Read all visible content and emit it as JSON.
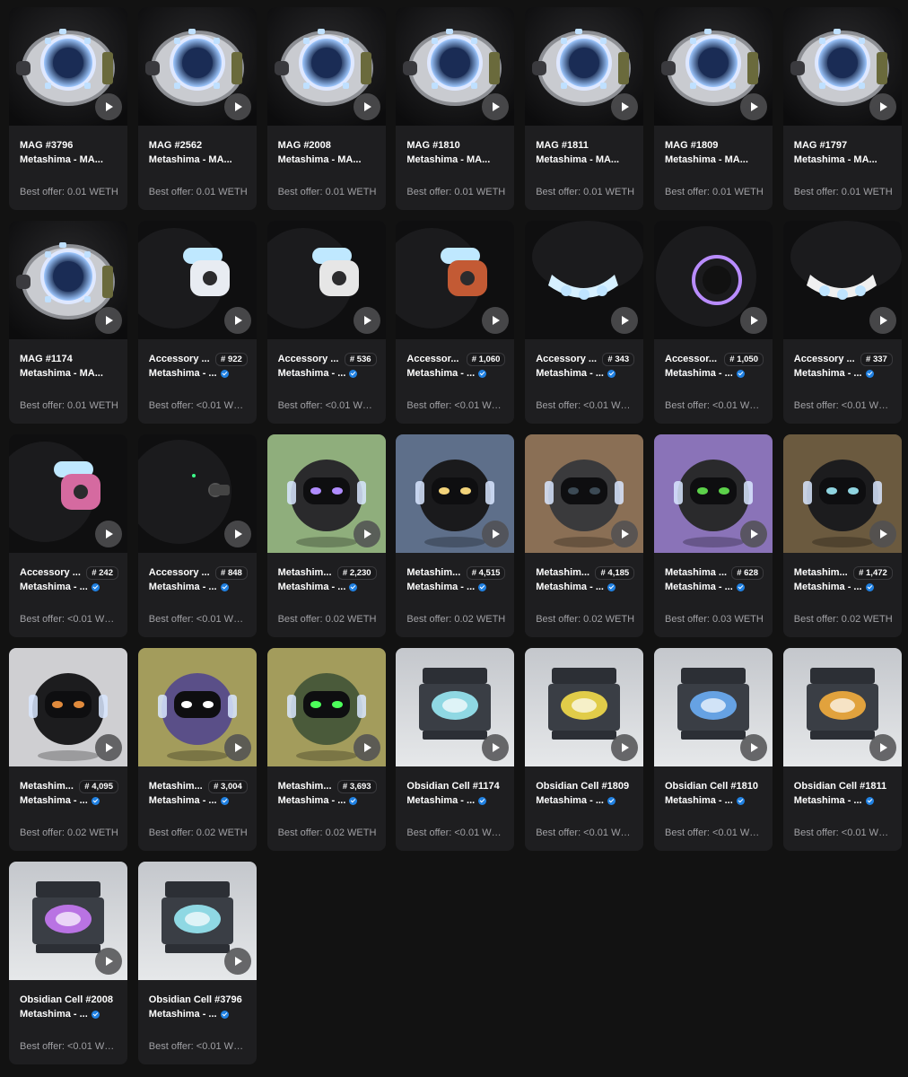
{
  "colors": {
    "background": "#121212",
    "card": "#1e1e20",
    "verified": "#2081e2",
    "muted_text": "#a0a0a4"
  },
  "offer_prefix": "Best offer: ",
  "cards": [
    {
      "title": "MAG #3796",
      "collection": "Metashima - MA...",
      "rank": "",
      "verified": false,
      "offer": "0.01 WETH",
      "image": "mag"
    },
    {
      "title": "MAG #2562",
      "collection": "Metashima - MA...",
      "rank": "",
      "verified": false,
      "offer": "0.01 WETH",
      "image": "mag"
    },
    {
      "title": "MAG #2008",
      "collection": "Metashima - MA...",
      "rank": "",
      "verified": false,
      "offer": "0.01 WETH",
      "image": "mag"
    },
    {
      "title": "MAG #1810",
      "collection": "Metashima - MA...",
      "rank": "",
      "verified": false,
      "offer": "0.01 WETH",
      "image": "mag"
    },
    {
      "title": "MAG #1811",
      "collection": "Metashima - MA...",
      "rank": "",
      "verified": false,
      "offer": "0.01 WETH",
      "image": "mag"
    },
    {
      "title": "MAG #1809",
      "collection": "Metashima - MA...",
      "rank": "",
      "verified": false,
      "offer": "0.01 WETH",
      "image": "mag"
    },
    {
      "title": "MAG #1797",
      "collection": "Metashima - MA...",
      "rank": "",
      "verified": false,
      "offer": "0.01 WETH",
      "image": "mag"
    },
    {
      "title": "MAG #1174",
      "collection": "Metashima - MA...",
      "rank": "",
      "verified": false,
      "offer": "0.01 WETH",
      "image": "mag"
    },
    {
      "title": "Accessory ...",
      "collection": "Metashima - ...",
      "rank": "# 922",
      "verified": true,
      "offer": "<0.01 WE...",
      "image": "acc-white"
    },
    {
      "title": "Accessory ...",
      "collection": "Metashima - ...",
      "rank": "# 536",
      "verified": true,
      "offer": "<0.01 WE...",
      "image": "acc-white2"
    },
    {
      "title": "Accessor...",
      "collection": "Metashima - ...",
      "rank": "# 1,060",
      "verified": true,
      "offer": "<0.01 WE...",
      "image": "acc-orange"
    },
    {
      "title": "Accessory ...",
      "collection": "Metashima - ...",
      "rank": "# 343",
      "verified": true,
      "offer": "<0.01 WE...",
      "image": "acc-legs"
    },
    {
      "title": "Accessor...",
      "collection": "Metashima - ...",
      "rank": "# 1,050",
      "verified": true,
      "offer": "<0.01 WE...",
      "image": "acc-purple"
    },
    {
      "title": "Accessory ...",
      "collection": "Metashima - ...",
      "rank": "# 337",
      "verified": true,
      "offer": "<0.01 WE...",
      "image": "acc-legs2"
    },
    {
      "title": "Accessory ...",
      "collection": "Metashima - ...",
      "rank": "# 242",
      "verified": true,
      "offer": "<0.01 WE...",
      "image": "acc-graffiti"
    },
    {
      "title": "Accessory ...",
      "collection": "Metashima - ...",
      "rank": "# 848",
      "verified": true,
      "offer": "<0.01 WE...",
      "image": "acc-dark"
    },
    {
      "title": "Metashim...",
      "collection": "Metashima - ...",
      "rank": "# 2,230",
      "verified": true,
      "offer": "0.02 WETH",
      "image": "bot-green"
    },
    {
      "title": "Metashim...",
      "collection": "Metashima - ...",
      "rank": "# 4,515",
      "verified": true,
      "offer": "0.02 WETH",
      "image": "bot-blue"
    },
    {
      "title": "Metashim...",
      "collection": "Metashima - ...",
      "rank": "# 4,185",
      "verified": true,
      "offer": "0.02 WETH",
      "image": "bot-brown"
    },
    {
      "title": "Metashima ...",
      "collection": "Metashima - ...",
      "rank": "# 628",
      "verified": true,
      "offer": "0.03 WETH",
      "image": "bot-purple"
    },
    {
      "title": "Metashim...",
      "collection": "Metashima - ...",
      "rank": "# 1,472",
      "verified": true,
      "offer": "0.02 WETH",
      "image": "bot-gold"
    },
    {
      "title": "Metashim...",
      "collection": "Metashima - ...",
      "rank": "# 4,095",
      "verified": true,
      "offer": "0.02 WETH",
      "image": "bot-grey"
    },
    {
      "title": "Metashim...",
      "collection": "Metashima - ...",
      "rank": "# 3,004",
      "verified": true,
      "offer": "0.02 WETH",
      "image": "bot-olive"
    },
    {
      "title": "Metashim...",
      "collection": "Metashima - ...",
      "rank": "# 3,693",
      "verified": true,
      "offer": "0.02 WETH",
      "image": "bot-camo"
    },
    {
      "title": "Obsidian Cell #1174",
      "collection": "Metashima - ...",
      "rank": "",
      "verified": true,
      "offer": "<0.01 WE...",
      "image": "cell-cyan"
    },
    {
      "title": "Obsidian Cell #1809",
      "collection": "Metashima - ...",
      "rank": "",
      "verified": true,
      "offer": "<0.01 WE...",
      "image": "cell-yellow"
    },
    {
      "title": "Obsidian Cell #1810",
      "collection": "Metashima - ...",
      "rank": "",
      "verified": true,
      "offer": "<0.01 WE...",
      "image": "cell-blue"
    },
    {
      "title": "Obsidian Cell #1811",
      "collection": "Metashima - ...",
      "rank": "",
      "verified": true,
      "offer": "<0.01 WE...",
      "image": "cell-orange"
    },
    {
      "title": "Obsidian Cell #2008",
      "collection": "Metashima - ...",
      "rank": "",
      "verified": true,
      "offer": "<0.01 WE...",
      "image": "cell-purple"
    },
    {
      "title": "Obsidian Cell #3796",
      "collection": "Metashima - ...",
      "rank": "",
      "verified": true,
      "offer": "<0.01 WE...",
      "image": "cell-cyan"
    }
  ]
}
